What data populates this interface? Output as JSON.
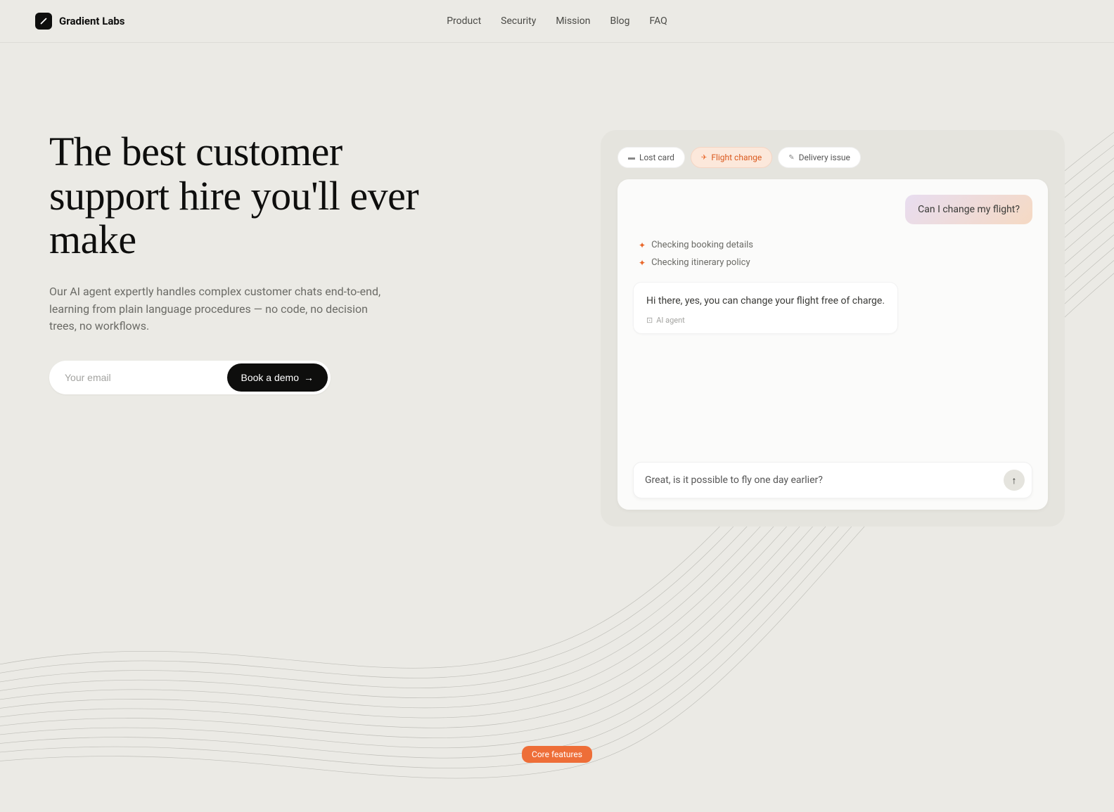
{
  "brand": "Gradient Labs",
  "nav": {
    "items": [
      "Product",
      "Security",
      "Mission",
      "Blog",
      "FAQ"
    ]
  },
  "hero": {
    "title": "The best customer support hire you'll ever make",
    "subtitle": "Our AI agent expertly handles complex customer chats end-to-end, learning from plain language procedures — no code, no decision trees, no workflows.",
    "email_placeholder": "Your email",
    "book_demo": "Book a demo"
  },
  "chat": {
    "tabs": [
      {
        "label": "Lost card",
        "icon": "💳",
        "active": false
      },
      {
        "label": "Flight change",
        "icon": "✈",
        "active": true
      },
      {
        "label": "Delivery issue",
        "icon": "🔧",
        "active": false
      }
    ],
    "user_msg": "Can I change my flight?",
    "status1": "Checking booking details",
    "status2": "Checking itinerary policy",
    "agent_msg": "Hi there, yes, you can change your flight free of charge.",
    "agent_label": "AI agent",
    "input_text": "Great, is it possible to fly one day earlier?"
  },
  "badge": "Core features"
}
